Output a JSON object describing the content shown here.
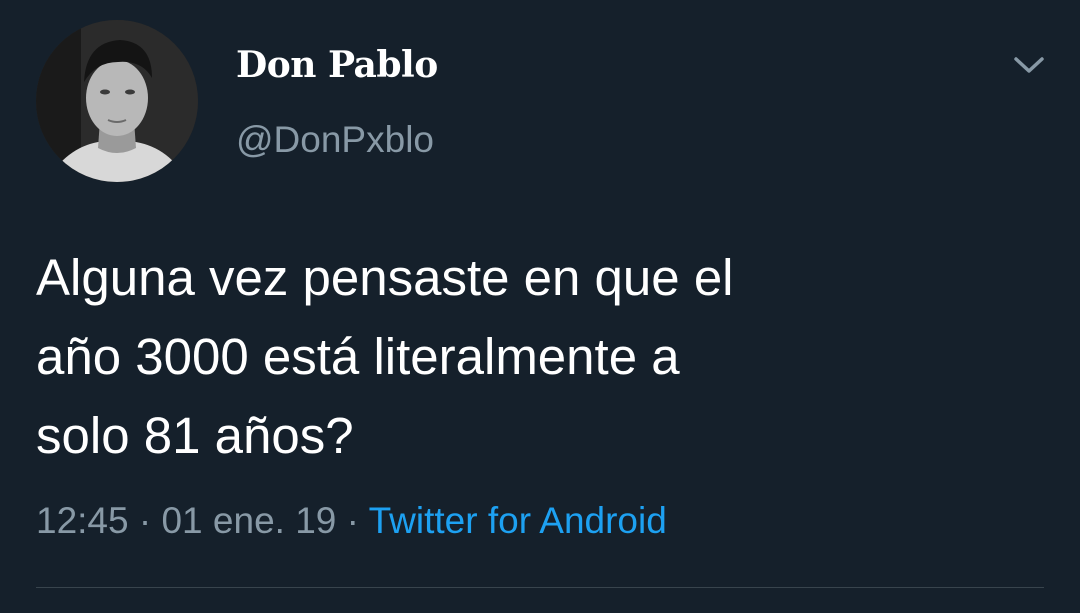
{
  "author": {
    "display_name": "Don Pablo",
    "handle": "@DonPxblo",
    "avatar_icon": "profile-photo"
  },
  "tweet": {
    "text": "Alguna vez pensaste en que el\naño 3000 está literalmente a\nsolo 81 años?",
    "time": "12:45",
    "separator": "·",
    "date": "01 ene. 19",
    "source": "Twitter for Android"
  },
  "menu": {
    "icon": "chevron-down-icon"
  },
  "colors": {
    "background": "#15202b",
    "primary_text": "#ffffff",
    "secondary_text": "#8899a6",
    "link": "#1da1f2",
    "divider": "#38444d"
  }
}
